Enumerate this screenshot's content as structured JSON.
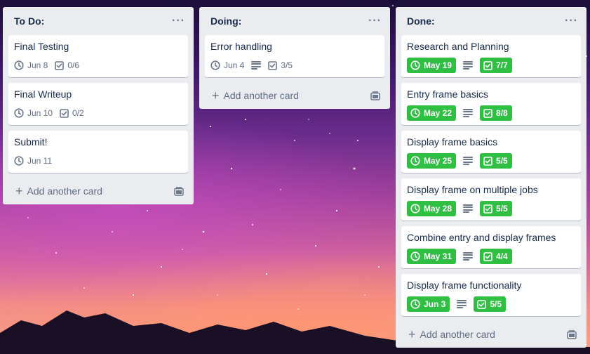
{
  "lists": [
    {
      "title": "To Do:",
      "add_label": "Add another card",
      "cards": [
        {
          "title": "Final Testing",
          "due": "Jun 8",
          "checklist": "0/6"
        },
        {
          "title": "Final Writeup",
          "due": "Jun 10",
          "checklist": "0/2"
        },
        {
          "title": "Submit!",
          "due": "Jun 11"
        }
      ]
    },
    {
      "title": "Doing:",
      "add_label": "Add another card",
      "cards": [
        {
          "title": "Error handling",
          "due": "Jun 4",
          "checklist": "3/5"
        }
      ]
    },
    {
      "title": "Done:",
      "add_label": "Add another card",
      "cards": [
        {
          "title": "Research and Planning",
          "due": "May 19",
          "checklist": "7/7"
        },
        {
          "title": "Entry frame basics",
          "due": "May 22",
          "checklist": "8/8"
        },
        {
          "title": "Display frame basics",
          "due": "May 25",
          "checklist": "5/5"
        },
        {
          "title": "Display frame on multiple jobs",
          "due": "May 28",
          "checklist": "5/5"
        },
        {
          "title": "Combine entry and display frames",
          "due": "May 31",
          "checklist": "4/4"
        },
        {
          "title": "Display frame functionality",
          "due": "Jun 3",
          "checklist": "5/5"
        }
      ]
    }
  ],
  "colors": {
    "complete_badge": "#2fbf43",
    "list_bg": "#ebecf0",
    "text": "#172b4d"
  },
  "icons": {
    "menu": "ellipsis-icon",
    "due": "clock-icon",
    "checklist": "checkbox-icon",
    "description": "description-icon",
    "template": "card-template-icon"
  }
}
